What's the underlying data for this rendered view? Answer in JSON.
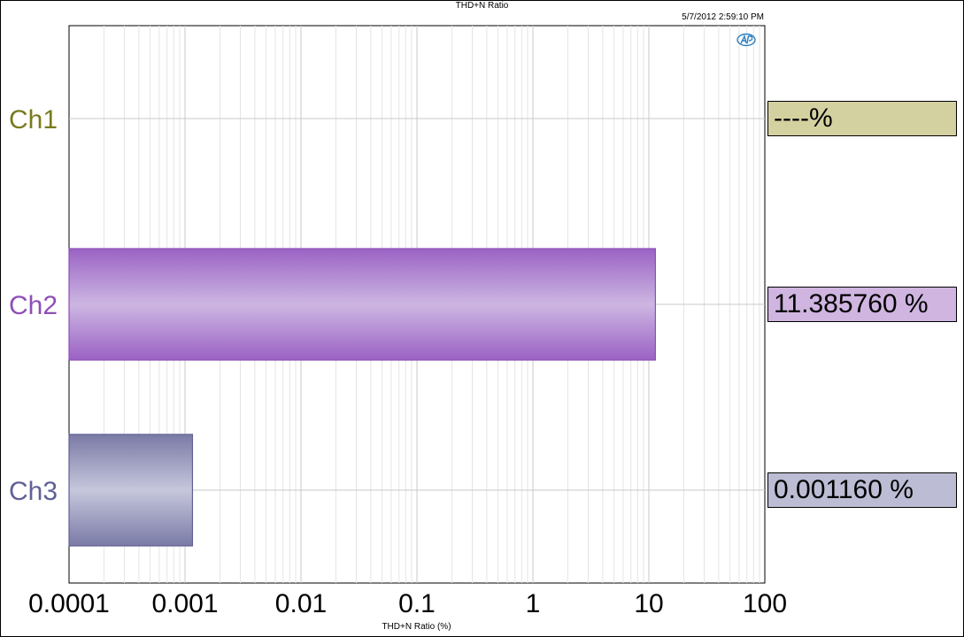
{
  "page": {
    "title": "THD+N Ratio",
    "timestamp": "5/7/2012 2:59:10 PM",
    "logo_icon": "ap-logo-icon"
  },
  "chart_data": {
    "type": "bar",
    "orientation": "horizontal",
    "title": "THD+N Ratio",
    "xlabel": "THD+N Ratio (%)",
    "ylabel": "",
    "x_scale": "log",
    "xlim": [
      0.0001,
      100
    ],
    "x_ticks": [
      "0.0001",
      "0.001",
      "0.01",
      "0.1",
      "1",
      "10",
      "100"
    ],
    "grid": true,
    "categories": [
      "Ch1",
      "Ch2",
      "Ch3"
    ],
    "values": [
      null,
      11.38576,
      0.00116
    ],
    "readouts": [
      "----%",
      "11.385760 %",
      "0.001160 %"
    ],
    "colors": {
      "Ch1": "#7a7a1e",
      "Ch2": "#8e4fb8",
      "Ch3": "#606096",
      "Ch1_readout_bg": "#d4d1a1",
      "Ch2_readout_bg": "#cfb5e0",
      "Ch3_readout_bg": "#bcbdd4"
    }
  }
}
